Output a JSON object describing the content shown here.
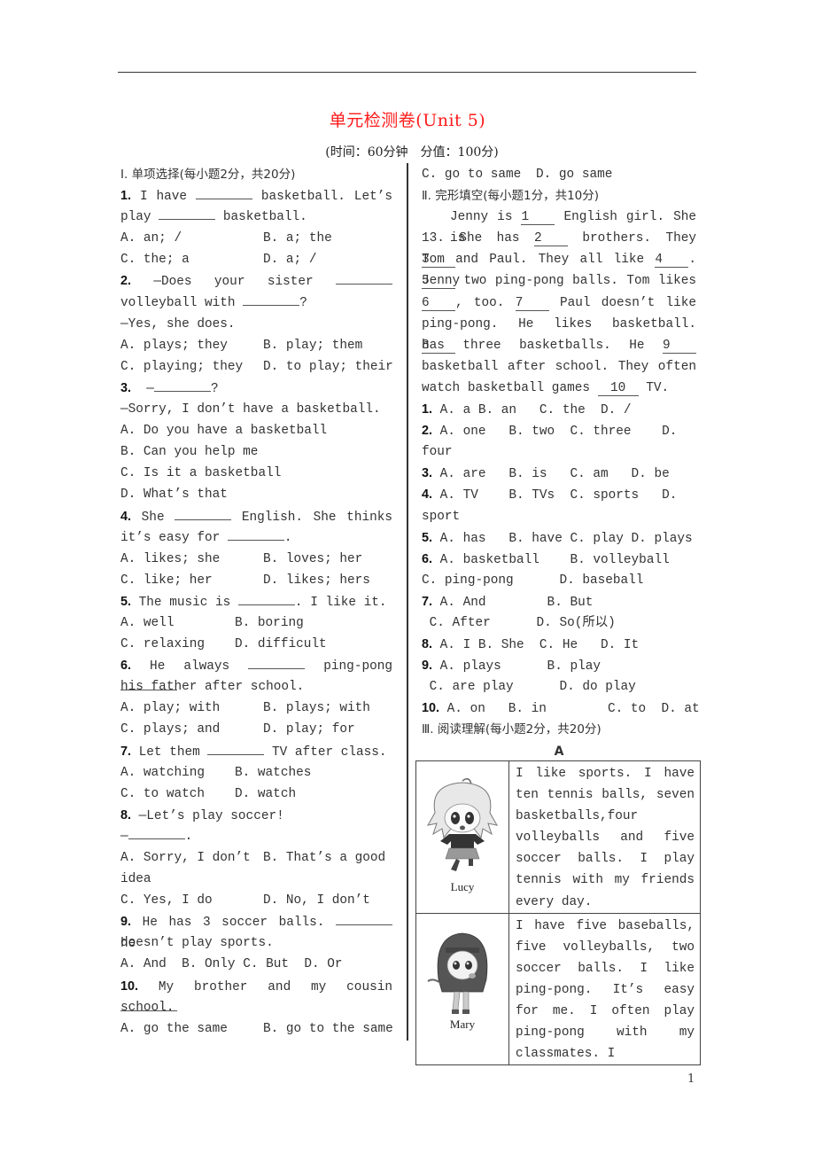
{
  "title": "单元检测卷(Unit 5)",
  "subtitle": "(时间：60分钟　分值：100分)",
  "title_color": "#ff1a1a",
  "section1": {
    "heading": "Ⅰ. 单项选择(每小题2分，共20分)",
    "questions": [
      {
        "num": "1.",
        "lines": [
          "I have ________ basketball. Let’s",
          "play ________ basketball."
        ],
        "options": [
          "A. an; /",
          "B. a; the",
          "C. the; a",
          "D. a; /"
        ]
      },
      {
        "num": "2.",
        "lines": [
          "—Does your sister ________",
          "volleyball with ________?",
          "—Yes, she does."
        ],
        "options": [
          "A. plays; they",
          "B. play; them",
          "C. playing; they",
          "D. to play; their"
        ]
      },
      {
        "num": "3.",
        "lines": [
          "—________?",
          "—Sorry, I don’t have a basketball."
        ],
        "options": [
          "A. Do you have a basketball",
          "B. Can you help me",
          "C. Is it a basketball",
          "D. What’s that"
        ]
      },
      {
        "num": "4.",
        "lines": [
          "She ________ English. She thinks",
          "it’s easy for ________."
        ],
        "options": [
          "A. likes; she",
          "B. loves; her",
          "C. like; her",
          "D. likes; hers"
        ]
      },
      {
        "num": "5.",
        "lines": [
          "The music is ________. I like it."
        ],
        "options": [
          "A. well",
          "B. boring",
          "C. relaxing",
          "D. difficult"
        ]
      },
      {
        "num": "6.",
        "lines": [
          "He always ________ ping-pong ________",
          "his father after school."
        ],
        "options": [
          "A. play; with",
          "B. plays; with",
          "C. plays; and",
          "D. play; for"
        ]
      },
      {
        "num": "7.",
        "lines": [
          "Let them ________ TV after class."
        ],
        "options": [
          "A. watching",
          "B. watches",
          "C. to watch",
          "D. watch"
        ]
      },
      {
        "num": "8.",
        "lines": [
          "—Let’s play soccer!",
          "—________."
        ],
        "options": [
          "A. Sorry, I don’t",
          "B. That’s a good idea",
          "C. Yes, I do",
          "D. No, I don’t"
        ]
      },
      {
        "num": "9.",
        "lines": [
          "He has 3 soccer balls. ________ he",
          "doesn’t play sports."
        ],
        "options": [
          "A. And",
          "B. Only",
          "C. But",
          "D. Or"
        ]
      },
      {
        "num": "10.",
        "lines": [
          "My brother and my cousin ________",
          "school."
        ],
        "options": [
          "A. go the same",
          "B. go to the same",
          "C. go to same",
          "D. go same"
        ]
      }
    ]
  },
  "section2": {
    "heading": "Ⅱ. 完形填空(每小题1分，共10分)",
    "passage_blanks": [
      "1",
      "2",
      "3",
      "4",
      "5",
      "6",
      "7",
      "8",
      "9",
      "10"
    ],
    "passage_text": [
      "Jenny is",
      "English girl. She is",
      "13. She has",
      "brothers. They",
      "Tom and Paul. They all like",
      ". Jenny",
      "two ping-pong balls. Tom likes",
      ",  too.",
      "Paul doesn’t like",
      "ping-pong. He likes basketball.",
      "has three basketballs. He",
      "basketball after school. They often",
      "watch basketball games",
      "TV."
    ],
    "options": [
      {
        "num": "1.",
        "text": "A. a B. an   C. the  D. /"
      },
      {
        "num": "2.",
        "text": "A. one   B. two  C. three    D.",
        "cont": "four"
      },
      {
        "num": "3.",
        "text": "A. are   B. is   C. am   D. be"
      },
      {
        "num": "4.",
        "text": "A. TV    B. TVs  C. sports   D.",
        "cont": "sport"
      },
      {
        "num": "5.",
        "text": "A. has   B. have C. play D. plays"
      },
      {
        "num": "6.",
        "text": "A. basketball    B. volleyball",
        "cont": "C. ping-pong      D. baseball"
      },
      {
        "num": "7.",
        "text": "A. And        B. But",
        "cont": " C. After      D. So(所以)"
      },
      {
        "num": "8.",
        "text": "A. I B. She  C. He   D. It"
      },
      {
        "num": "9.",
        "text": "A. plays      B. play",
        "cont": " C. are play      D. do play"
      },
      {
        "num": "10.",
        "text": "A. on   B. in        C. to  D. at"
      }
    ]
  },
  "section3": {
    "heading": "Ⅲ. 阅读理解(每小题2分，共20分)",
    "passage_label": "A",
    "rows": [
      {
        "name": "Lucy",
        "text": "I like sports. I have ten tennis balls, seven basketballs,four volleyballs and five soccer balls. I play tennis with my friends every day."
      },
      {
        "name": "Mary",
        "text": "I have five baseballs, five volleyballs, two soccer balls. I like ping-pong. It’s easy for me. I often play ping-pong with my classmates. I"
      }
    ]
  },
  "page_number": "1"
}
